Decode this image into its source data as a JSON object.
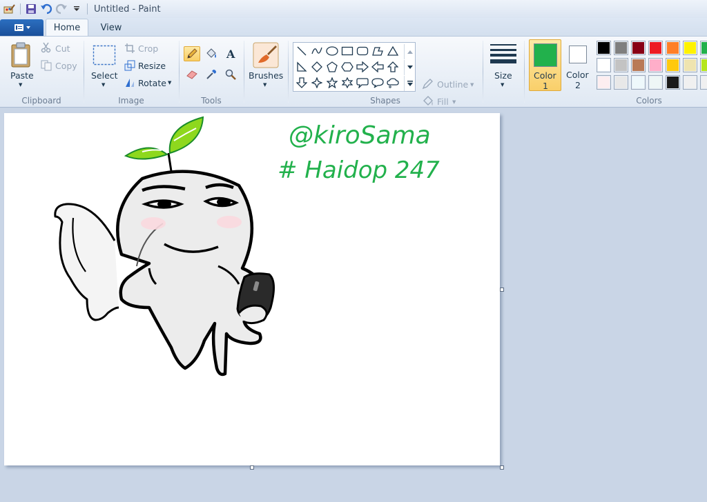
{
  "window": {
    "title": "Untitled - Paint"
  },
  "quick_access": [
    {
      "icon": "paint-app-icon"
    },
    {
      "icon": "save-icon"
    },
    {
      "icon": "undo-icon"
    },
    {
      "icon": "redo-icon"
    },
    {
      "icon": "customize-dropdown-icon"
    }
  ],
  "tabs": {
    "home": "Home",
    "view": "View"
  },
  "ribbon": {
    "clipboard": {
      "paste": "Paste",
      "cut": "Cut",
      "copy": "Copy",
      "group": "Clipboard"
    },
    "image": {
      "select": "Select",
      "crop": "Crop",
      "resize": "Resize",
      "rotate": "Rotate",
      "group": "Image"
    },
    "tools": {
      "group": "Tools",
      "active_tool": "pencil"
    },
    "brushes": {
      "label": "Brushes"
    },
    "shapes": {
      "outline": "Outline",
      "fill": "Fill",
      "group": "Shapes"
    },
    "size": {
      "label": "Size"
    },
    "colors": {
      "color1_label": "Color",
      "color1_num": "1",
      "color2_label": "Color",
      "color2_num": "2",
      "color1_value": "#22b14c",
      "color2_value": "#ffffff",
      "group": "Colors",
      "palette": [
        [
          "#000000",
          "#7f7f7f",
          "#880015",
          "#ed1c24",
          "#ff7f27",
          "#fff200",
          "#22b14c"
        ],
        [
          "#ffffff",
          "#c3c3c3",
          "#b97a57",
          "#ffaec9",
          "#ffc90e",
          "#efe4b0",
          "#b5e61d"
        ],
        [
          "#fdeef0",
          "#e8e8e8",
          "#eef8fb",
          "#eef6f6",
          "#1a1a1a",
          "#f0f0f0",
          "#f0f0f0"
        ]
      ]
    }
  },
  "canvas": {
    "text_line_1": "@kiroSama",
    "text_line_2": "# Haidop 247",
    "ink_color": "#22b14c"
  }
}
